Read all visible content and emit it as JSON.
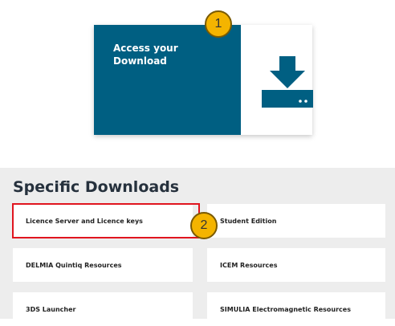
{
  "hero": {
    "title": "Access your Download",
    "callout": "1"
  },
  "specific_downloads": {
    "heading": "Specific Downloads",
    "callout": "2",
    "tiles": [
      {
        "label": "Licence Server and Licence keys"
      },
      {
        "label": "Student Edition"
      },
      {
        "label": "DELMIA Quintiq Resources"
      },
      {
        "label": "ICEM Resources"
      },
      {
        "label": "3DS Launcher"
      },
      {
        "label": "SIMULIA Electromagnetic Resources"
      }
    ]
  },
  "colors": {
    "brand": "#005f82",
    "callout": "#f4b400",
    "highlight": "#e0151f"
  }
}
